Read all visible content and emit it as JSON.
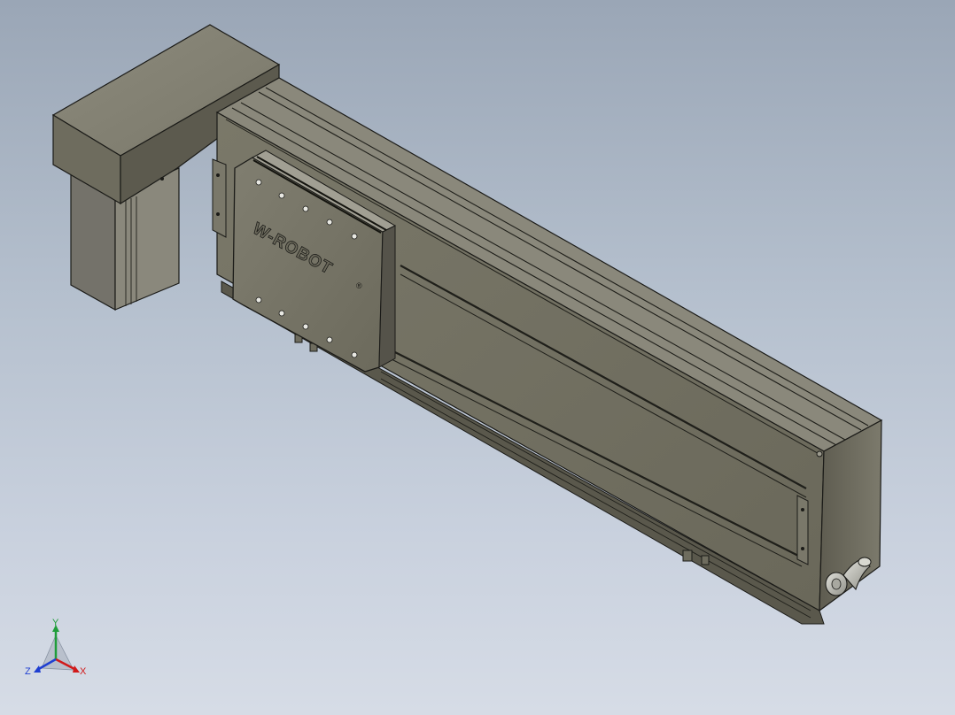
{
  "model": {
    "logo_text": "W-ROBOT",
    "registered_mark": "®"
  },
  "triad": {
    "x_label": "X",
    "y_label": "Y",
    "z_label": "Z",
    "colors": {
      "x": "#d11a1a",
      "y": "#1f9d3a",
      "z": "#1f3fd1"
    }
  },
  "colors": {
    "background_top": "#9aa6b6",
    "background_bottom": "#d6dce6",
    "body_light": "#8a8878",
    "body_mid": "#6f6d5f",
    "body_dark": "#4f4d43",
    "edge": "#1b1b18"
  }
}
